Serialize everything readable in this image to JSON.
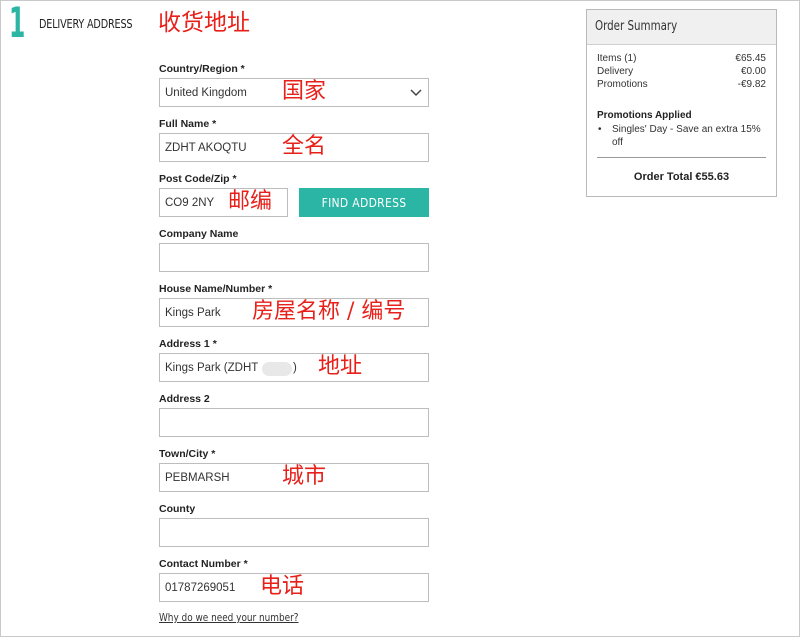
{
  "step": {
    "number": "1",
    "title": "DELIVERY ADDRESS"
  },
  "annotations": {
    "heading": "收货地址",
    "country": "国家",
    "full_name": "全名",
    "postcode": "邮编",
    "house": "房屋名称 / 编号",
    "address": "地址",
    "town": "城市",
    "contact": "电话"
  },
  "form": {
    "country": {
      "label": "Country/Region *",
      "value": "United Kingdom"
    },
    "full_name": {
      "label": "Full Name *",
      "value": "ZDHT AKOQTU"
    },
    "postcode": {
      "label": "Post Code/Zip *",
      "value": "CO9 2NY"
    },
    "find_button": "FIND ADDRESS",
    "company": {
      "label": "Company Name",
      "value": ""
    },
    "house": {
      "label": "House Name/Number *",
      "value": "Kings Park"
    },
    "address1": {
      "label": "Address 1 *",
      "value_start": "Kings Park (ZDHT",
      "value_end": ")"
    },
    "address2": {
      "label": "Address 2",
      "value": ""
    },
    "town": {
      "label": "Town/City *",
      "value": "PEBMARSH"
    },
    "county": {
      "label": "County",
      "value": ""
    },
    "contact": {
      "label": "Contact Number *",
      "value": "01787269051"
    },
    "why_link": "Why do we need your number?"
  },
  "summary": {
    "title": "Order Summary",
    "items_label": "Items (1)",
    "items_value": "€65.45",
    "delivery_label": "Delivery",
    "delivery_value": "€0.00",
    "promotions_label": "Promotions",
    "promotions_value": "-€9.82",
    "promos_heading": "Promotions Applied",
    "promo_item": "Singles' Day - Save an extra 15% off",
    "total": "Order Total €55.63"
  },
  "colors": {
    "accent": "#2bb5a5",
    "annotation": "#e8201a"
  },
  "icons": {
    "dropdown": "chevron-down-icon"
  }
}
